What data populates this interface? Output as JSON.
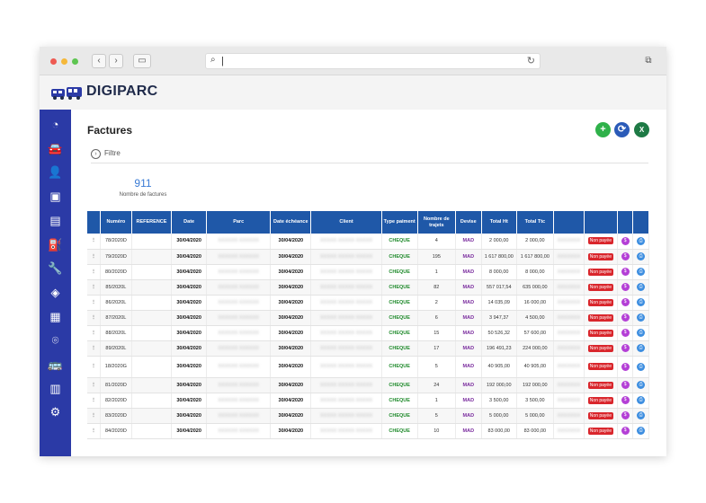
{
  "app": {
    "name": "DIGIPARC"
  },
  "browser": {
    "url_value": "|"
  },
  "colors": {
    "sidebar": "#2b3aa6",
    "table_header": "#1f58a8",
    "badge": "#d9262c",
    "add": "#2fb14a",
    "refresh": "#2b5bb8",
    "excel": "#1e7a45"
  },
  "sidebar": {
    "items": [
      {
        "icon": "dashboard-icon",
        "glyph": "◔"
      },
      {
        "icon": "car-icon",
        "glyph": "🚘"
      },
      {
        "icon": "user-icon",
        "glyph": "👤"
      },
      {
        "icon": "id-badge-icon",
        "glyph": "▣"
      },
      {
        "icon": "document-icon",
        "glyph": "▤"
      },
      {
        "icon": "fuel-pump-icon",
        "glyph": "⛽"
      },
      {
        "icon": "wrench-icon",
        "glyph": "🔧"
      },
      {
        "icon": "layers-icon",
        "glyph": "◈"
      },
      {
        "icon": "building-icon",
        "glyph": "▦"
      },
      {
        "icon": "map-pin-icon",
        "glyph": "⌾"
      },
      {
        "icon": "bus-icon",
        "glyph": "🚌"
      },
      {
        "icon": "files-icon",
        "glyph": "▥"
      },
      {
        "icon": "gear-icon",
        "glyph": "⚙"
      }
    ]
  },
  "page": {
    "title": "Factures",
    "filter_label": "Filtre",
    "kpi": {
      "value": "911",
      "label": "Nombre de factures"
    }
  },
  "table": {
    "headers": [
      "",
      "Numéro",
      "REFERENCE",
      "Date",
      "Parc",
      "Date échéance",
      "Client",
      "Type paiment",
      "Nombre de trajets",
      "Devise",
      "Total Ht",
      "Total Ttc",
      "",
      "",
      "",
      ""
    ],
    "status_label": "Non payée",
    "rows": [
      {
        "numero": "78/2020D",
        "date": "30/04/2020",
        "echeance": "30/04/2020",
        "type": "CHEQUE",
        "trajets": "4",
        "devise": "MAD",
        "ht": "2 000,00",
        "ttc": "2 000,00"
      },
      {
        "numero": "79/2020D",
        "date": "30/04/2020",
        "echeance": "30/04/2020",
        "type": "CHEQUE",
        "trajets": "195",
        "devise": "MAD",
        "ht": "1 617 800,00",
        "ttc": "1 617 800,00"
      },
      {
        "numero": "80/2020D",
        "date": "30/04/2020",
        "echeance": "30/04/2020",
        "type": "CHEQUE",
        "trajets": "1",
        "devise": "MAD",
        "ht": "8 000,00",
        "ttc": "8 000,00"
      },
      {
        "numero": "85/2020L",
        "date": "30/04/2020",
        "echeance": "30/04/2020",
        "type": "CHEQUE",
        "trajets": "82",
        "devise": "MAD",
        "ht": "557 017,54",
        "ttc": "635 000,00"
      },
      {
        "numero": "86/2020L",
        "date": "30/04/2020",
        "echeance": "30/04/2020",
        "type": "CHEQUE",
        "trajets": "2",
        "devise": "MAD",
        "ht": "14 035,09",
        "ttc": "16 000,00"
      },
      {
        "numero": "87/2020L",
        "date": "30/04/2020",
        "echeance": "30/04/2020",
        "type": "CHEQUE",
        "trajets": "6",
        "devise": "MAD",
        "ht": "3 947,37",
        "ttc": "4 500,00"
      },
      {
        "numero": "88/2020L",
        "date": "30/04/2020",
        "echeance": "30/04/2020",
        "type": "CHEQUE",
        "trajets": "15",
        "devise": "MAD",
        "ht": "50 526,32",
        "ttc": "57 600,00"
      },
      {
        "numero": "89/2020L",
        "date": "30/04/2020",
        "echeance": "30/04/2020",
        "type": "CHEQUE",
        "trajets": "17",
        "devise": "MAD",
        "ht": "196 491,23",
        "ttc": "224 000,00"
      },
      {
        "numero": "18/2020G",
        "date": "30/04/2020",
        "echeance": "30/04/2020",
        "type": "CHEQUE",
        "trajets": "5",
        "devise": "MAD",
        "ht": "40 905,00",
        "ttc": "40 905,00"
      },
      {
        "numero": "81/2020D",
        "date": "30/04/2020",
        "echeance": "30/04/2020",
        "type": "CHEQUE",
        "trajets": "24",
        "devise": "MAD",
        "ht": "192 000,00",
        "ttc": "192 000,00"
      },
      {
        "numero": "82/2020D",
        "date": "30/04/2020",
        "echeance": "30/04/2020",
        "type": "CHEQUE",
        "trajets": "1",
        "devise": "MAD",
        "ht": "3 500,00",
        "ttc": "3 500,00"
      },
      {
        "numero": "83/2020D",
        "date": "30/04/2020",
        "echeance": "30/04/2020",
        "type": "CHEQUE",
        "trajets": "5",
        "devise": "MAD",
        "ht": "5 000,00",
        "ttc": "5 000,00"
      },
      {
        "numero": "84/2020D",
        "date": "30/04/2020",
        "echeance": "30/04/2020",
        "type": "CHEQUE",
        "trajets": "10",
        "devise": "MAD",
        "ht": "83 000,00",
        "ttc": "83 000,00"
      }
    ]
  }
}
